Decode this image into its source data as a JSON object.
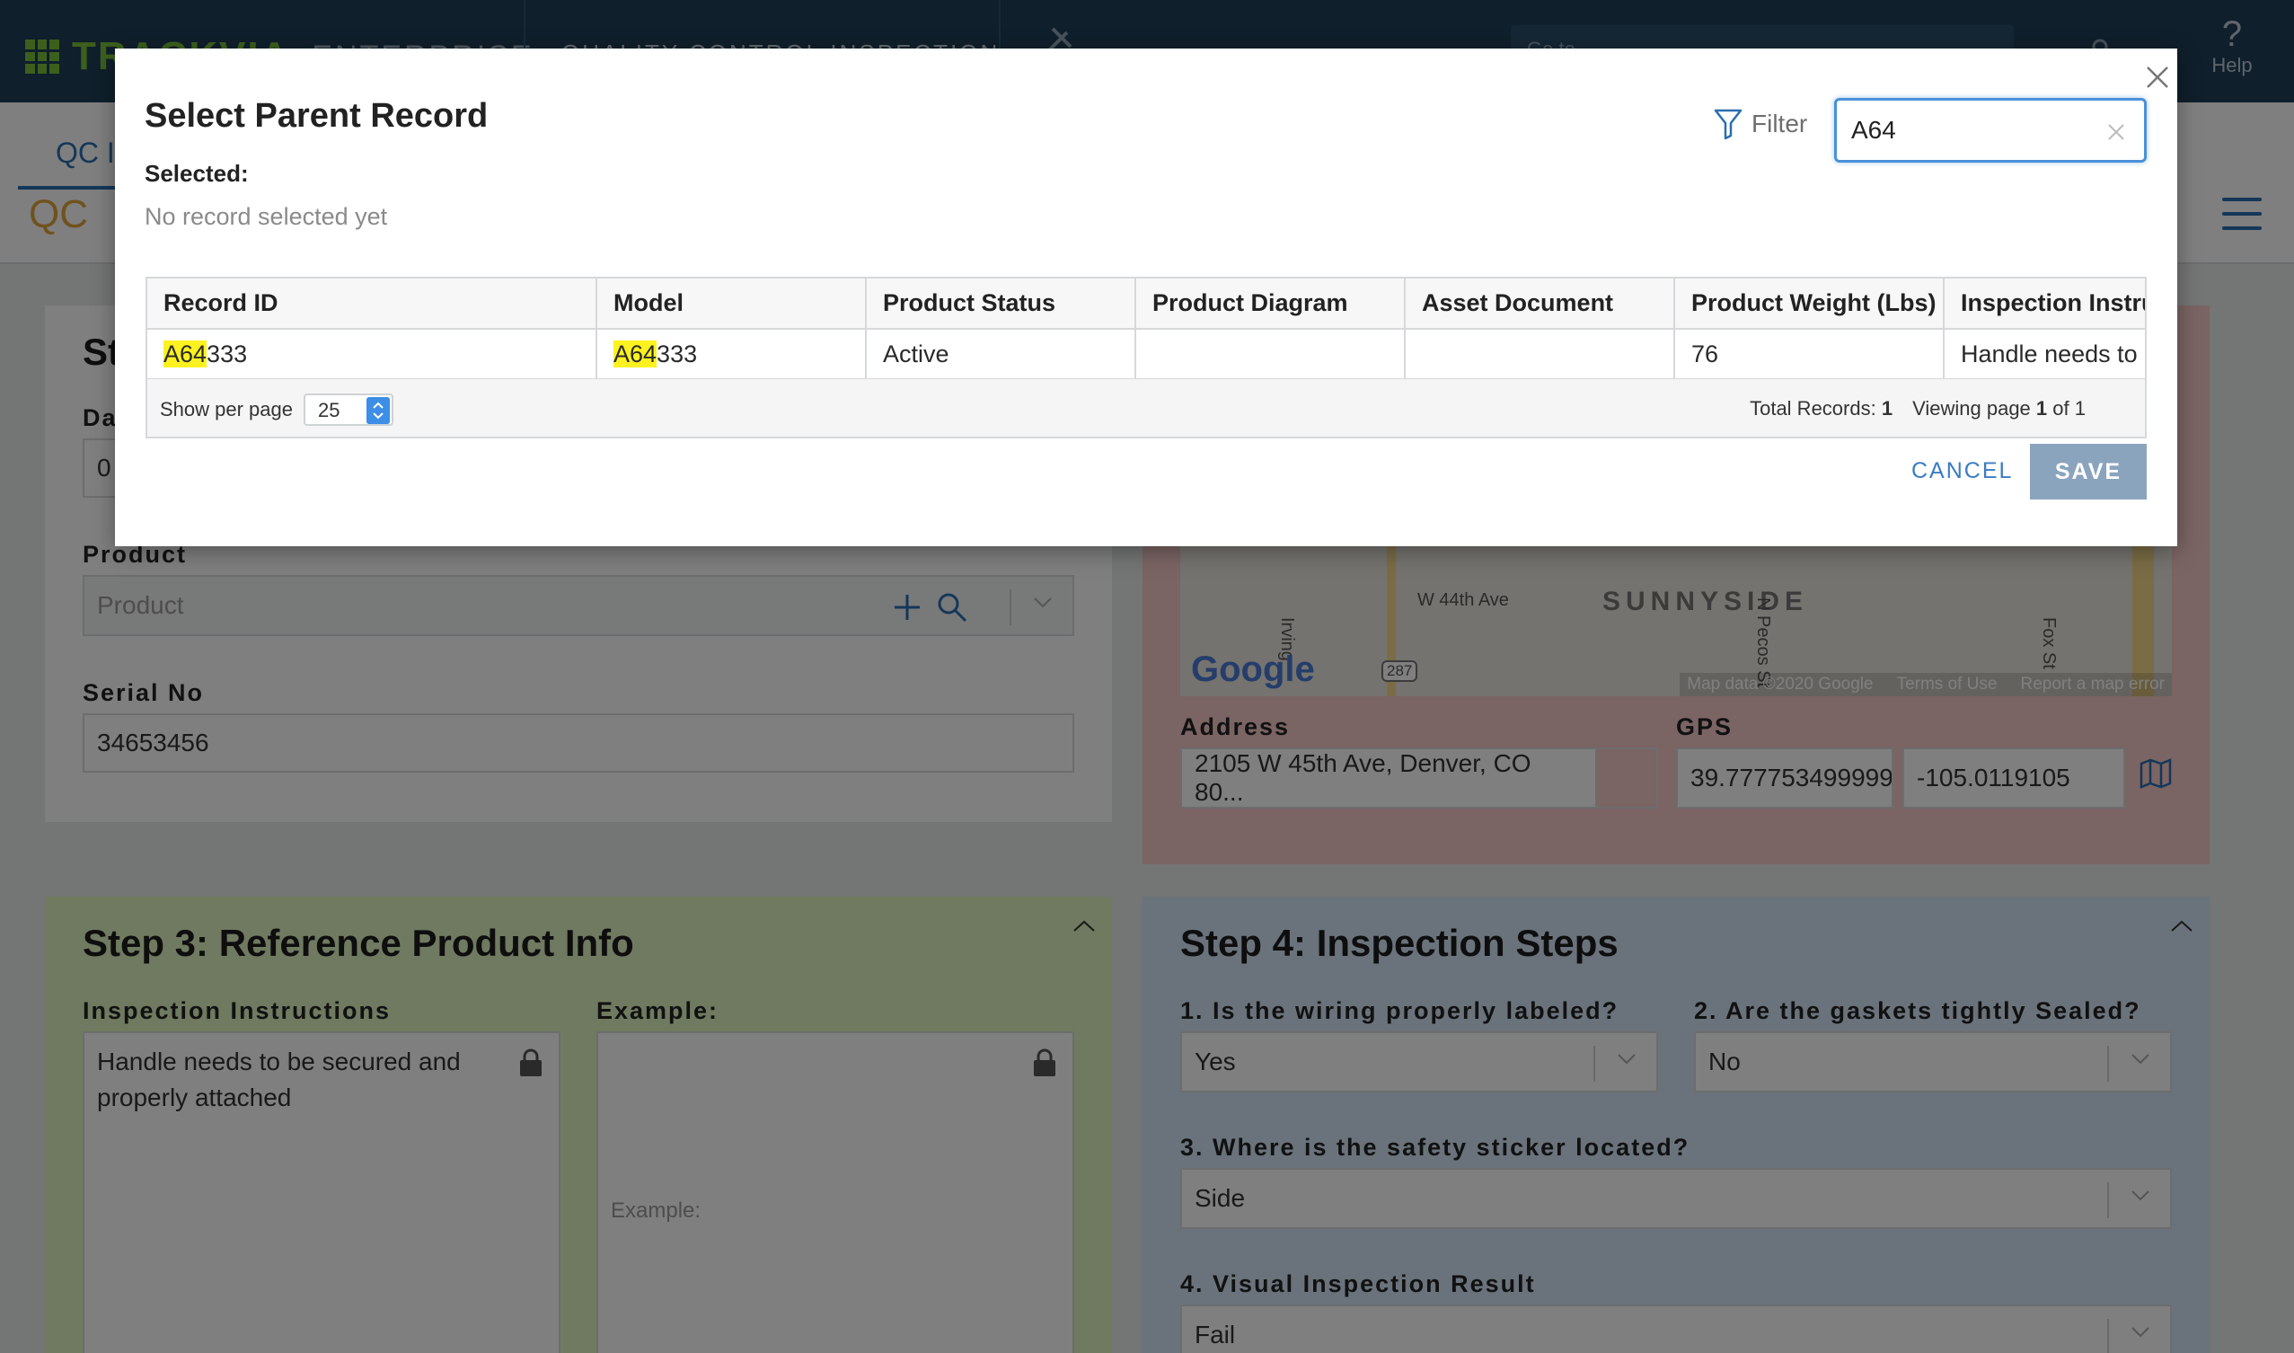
{
  "topnav": {
    "logo": "TRACKVIA",
    "edition": "ENTERPRISE",
    "app_name": "QUALITY CONTROL INSPECTION",
    "goto_placeholder": "Go to",
    "help_label": "Help",
    "help_glyph": "?"
  },
  "subnav": {
    "tab_label": "QC I",
    "page_title": "QC"
  },
  "panel1": {
    "title_fragment": "St",
    "date_label_fragment": "Da",
    "date_value_fragment": "0",
    "product_label": "Product",
    "product_placeholder": "Product",
    "serial_label": "Serial No",
    "serial_value": "34653456"
  },
  "panel2": {
    "map": {
      "street_1": "W 44th Ave",
      "neighborhood": "SUNNYSIDE",
      "street_2": "N Pecos St",
      "street_3": "Irving",
      "street_4": "Fox St",
      "route": "287",
      "brand": "Google",
      "footer_data": "Map data ©2020 Google",
      "footer_terms": "Terms of Use",
      "footer_report": "Report a map error"
    },
    "address_label": "Address",
    "address_value": "2105 W 45th Ave, Denver, CO 80...",
    "gps_label": "GPS",
    "gps_lat": "39.777753499999",
    "gps_lng": "-105.0119105"
  },
  "panel3": {
    "title": "Step 3: Reference Product Info",
    "instructions_label": "Inspection Instructions",
    "instructions_value": "Handle needs to be secured and properly attached",
    "example_label": "Example:",
    "example_placeholder": "Example:"
  },
  "panel4": {
    "title": "Step 4: Inspection Steps",
    "q1_label": "1. Is the wiring properly labeled?",
    "q1_value": "Yes",
    "q2_label": "2. Are the gaskets tightly Sealed?",
    "q2_value": "No",
    "q3_label": "3. Where is the safety sticker located?",
    "q3_value": "Side",
    "q4_label": "4. Visual Inspection Result",
    "q4_value": "Fail"
  },
  "modal": {
    "title": "Select Parent Record",
    "selected_label": "Selected:",
    "selected_value": "No record selected yet",
    "filter_label": "Filter",
    "search_value": "A64",
    "columns": [
      "Record ID",
      "Model",
      "Product Status",
      "Product Diagram",
      "Asset Document",
      "Product Weight (Lbs)",
      "Inspection Instru"
    ],
    "row": {
      "record_id_match": "A64",
      "record_id_rest": "333",
      "model_match": "A64",
      "model_rest": "333",
      "status": "Active",
      "diagram": "",
      "asset": "",
      "weight": "76",
      "instructions": "Handle needs to"
    },
    "show_per_page_label": "Show per page",
    "per_page_value": "25",
    "total_records_label": "Total Records:",
    "total_records_value": "1",
    "viewing_label": "Viewing page",
    "page_current": "1",
    "page_of": "of 1",
    "cancel_label": "CANCEL",
    "save_label": "SAVE"
  },
  "colors": {
    "nav_bg": "#1f3f57",
    "accent_blue": "#2a6fb0",
    "highlight": "#fdf21f",
    "save_disabled": "#8ba4bd",
    "panel_step2": "#f6c9c9",
    "panel_step3": "#dff5c0",
    "panel_step4": "#d5e7f6"
  }
}
